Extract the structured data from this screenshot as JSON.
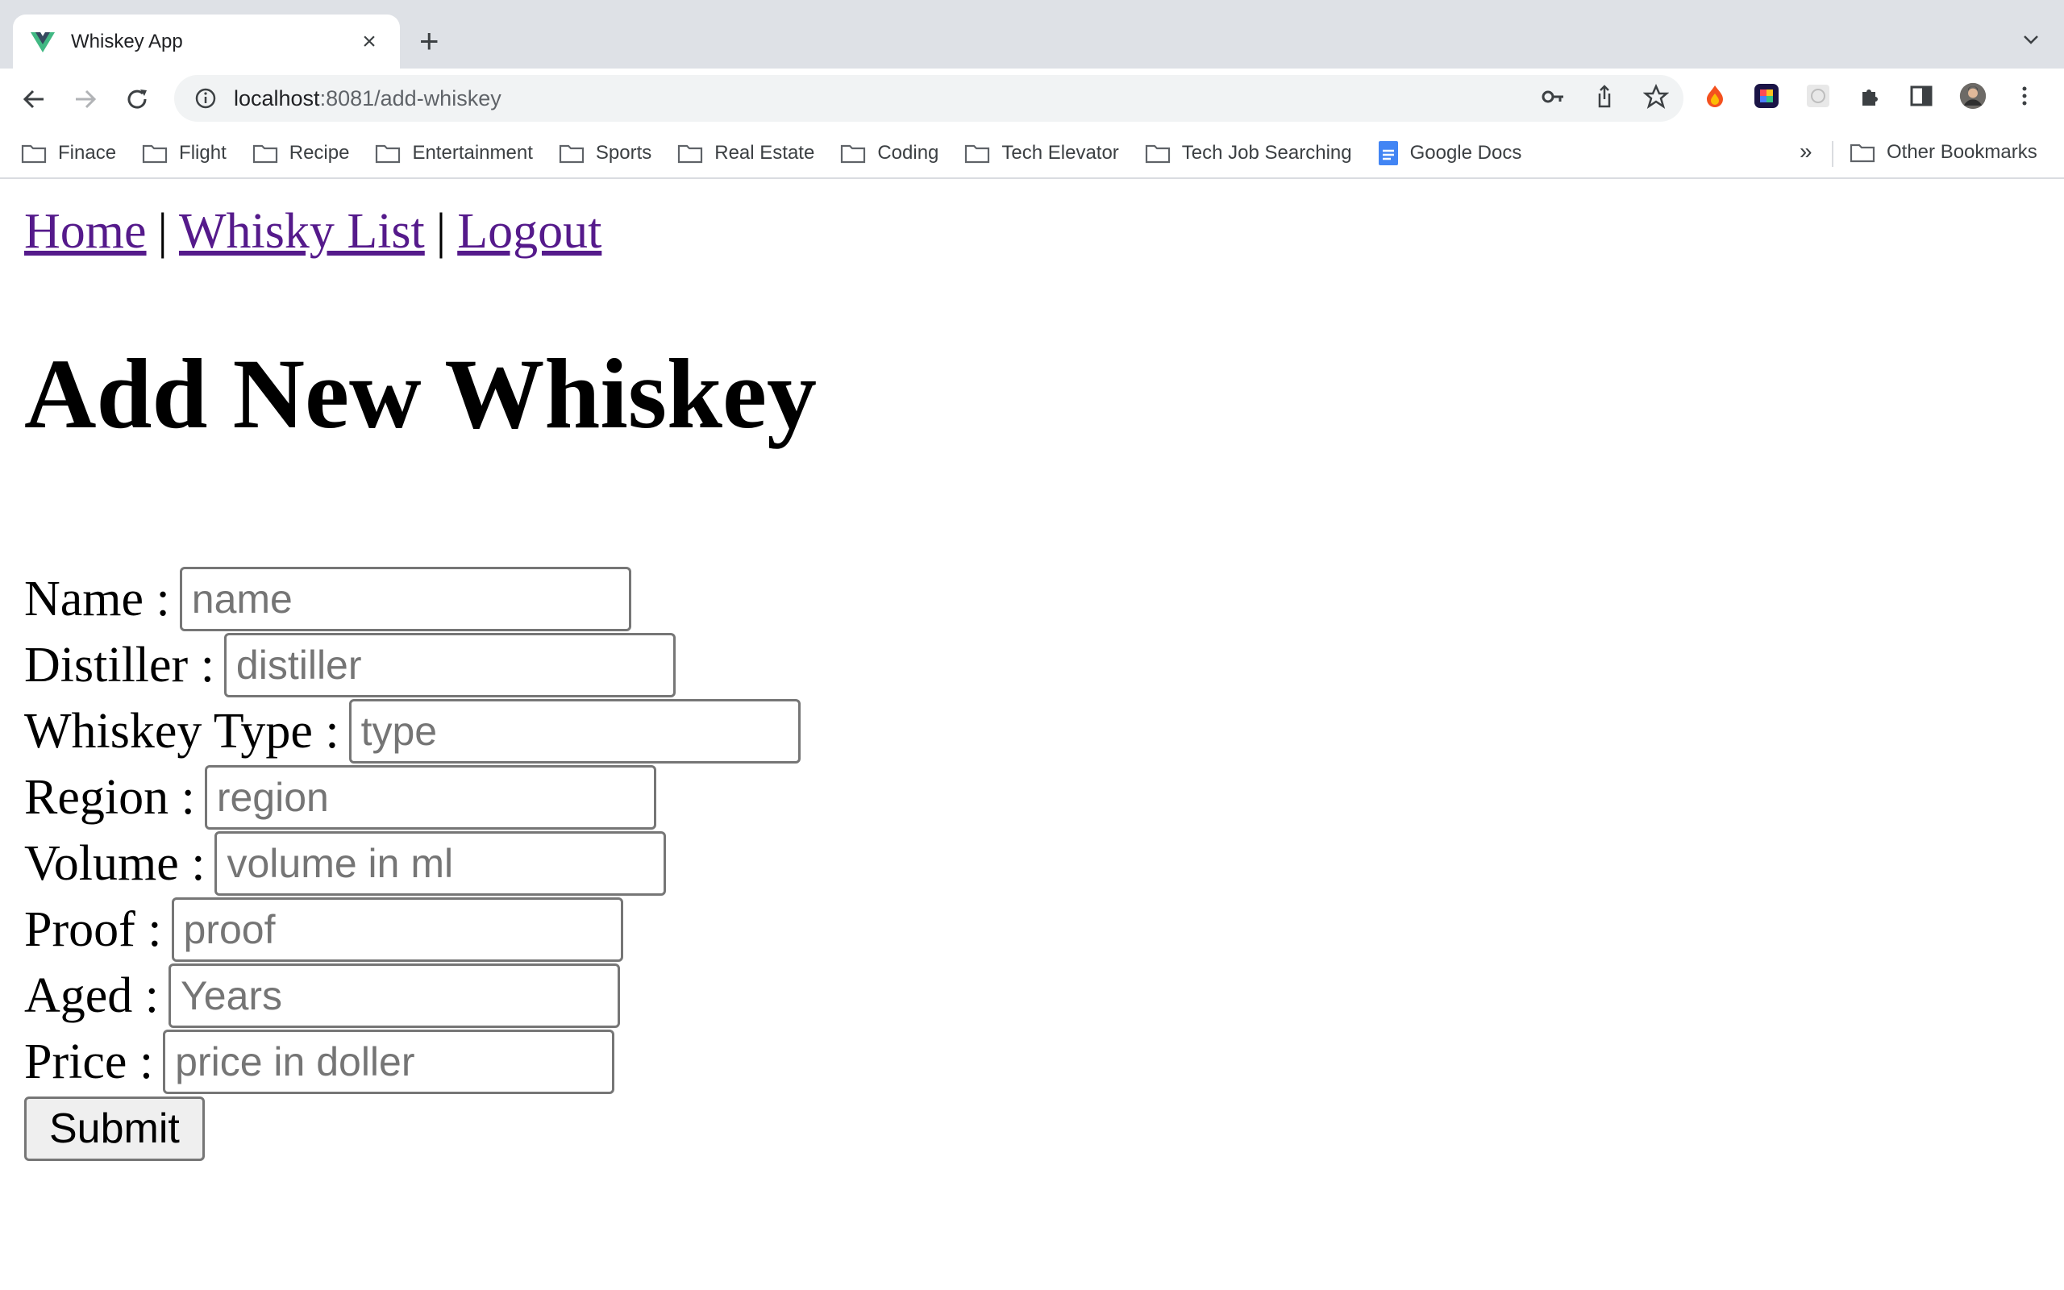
{
  "browser": {
    "tab_title": "Whiskey App",
    "url_host": "localhost",
    "url_path": ":8081/add-whiskey",
    "bookmarks": [
      "Finace",
      "Flight",
      "Recipe",
      "Entertainment",
      "Sports",
      "Real Estate",
      "Coding",
      "Tech Elevator",
      "Tech Job Searching",
      "Google Docs"
    ],
    "bookmarks_more": "»",
    "other_bookmarks": "Other Bookmarks"
  },
  "nav": {
    "home": "Home",
    "separator": "|",
    "whisky_list": "Whisky List",
    "logout": "Logout"
  },
  "page_title": "Add New Whiskey",
  "form": {
    "name": {
      "label": "Name :",
      "placeholder": "name"
    },
    "distiller": {
      "label": "Distiller :",
      "placeholder": "distiller"
    },
    "type": {
      "label": "Whiskey Type :",
      "placeholder": "type"
    },
    "region": {
      "label": "Region :",
      "placeholder": "region"
    },
    "volume": {
      "label": "Volume :",
      "placeholder": "volume in ml"
    },
    "proof": {
      "label": "Proof :",
      "placeholder": "proof"
    },
    "aged": {
      "label": "Aged :",
      "placeholder": "Years"
    },
    "price": {
      "label": "Price :",
      "placeholder": "price in doller"
    },
    "submit": "Submit"
  }
}
